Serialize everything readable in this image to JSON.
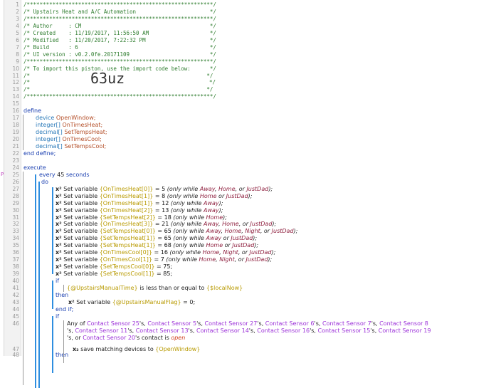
{
  "lines": [
    {
      "n": "1",
      "text": "/**********************************************************/"
    },
    {
      "n": "2",
      "text": "/* Upstairs Heat and A/C Automation                       */"
    },
    {
      "n": "3",
      "text": "/**********************************************************/"
    },
    {
      "n": "4",
      "text": "/* Author     : CM                                        */"
    },
    {
      "n": "5",
      "text": "/* Created    : 11/19/2017, 11:56:50 AM                   */"
    },
    {
      "n": "6",
      "text": "/* Modified   : 11/20/2017, 7:22:32 PM                    */"
    },
    {
      "n": "7",
      "text": "/* Build      : 6                                         */"
    },
    {
      "n": "8",
      "text": "/* UI version : v0.2.0fe.20171109                         */"
    },
    {
      "n": "9",
      "text": "/**********************************************************/"
    },
    {
      "n": "10",
      "text": "/* To import this piston, use the import code below:      */"
    },
    {
      "n": "11",
      "text": "/*                                                       */"
    },
    {
      "n": "12a",
      "text": "/*"
    },
    {
      "n": "12b",
      "text": "*/"
    },
    {
      "n": "13",
      "text": "/*                                                       */"
    },
    {
      "n": "14",
      "text": "/**********************************************************/"
    }
  ],
  "import_code": "63uz",
  "line_numbers": [
    "1",
    "2",
    "3",
    "4",
    "5",
    "6",
    "7",
    "8",
    "9",
    "10",
    "11",
    "12",
    "13",
    "14",
    "15",
    "16",
    "17",
    "18",
    "19",
    "20",
    "21",
    "22",
    "23",
    "24",
    "25",
    "26",
    "27",
    "28",
    "29",
    "30",
    "31",
    "32",
    "33",
    "34",
    "35",
    "36",
    "37",
    "38",
    "39",
    "40",
    "41",
    "42",
    "43",
    "44",
    "45",
    "46",
    "47",
    "48"
  ],
  "define": {
    "kw_define": "define",
    "decls": [
      {
        "type": "device",
        "name": "OpenWindow;"
      },
      {
        "type": "integer[]",
        "name": "OnTimesHeat;"
      },
      {
        "type": "decimal[]",
        "name": "SetTempsHeat;"
      },
      {
        "type": "integer[]",
        "name": "OnTimesCool;"
      },
      {
        "type": "decimal[]",
        "name": "SetTempsCool;"
      }
    ],
    "end": "end define;"
  },
  "execute": {
    "kw": "execute",
    "every": "every",
    "every_num": "45",
    "every_unit": "seconds",
    "do": "do",
    "sets": [
      {
        "var": "{OnTimesHeat[0]}",
        "val": "5",
        "cond": "(only while Away, Home, or JustDad);"
      },
      {
        "var": "{OnTimesHeat[1]}",
        "val": "8",
        "cond": "(only while Home or JustDad);"
      },
      {
        "var": "{OnTimesHeat[1]}",
        "val": "12",
        "cond": "(only while Away);"
      },
      {
        "var": "{OnTimesHeat[2]}",
        "val": "13",
        "cond": "(only while Away);"
      },
      {
        "var": "{SetTempsHeat[2]}",
        "val": "18",
        "cond": "(only while Home);"
      },
      {
        "var": "{OnTimesHeat[3]}",
        "val": "21",
        "cond": "(only while Away, Home, or JustDad);"
      },
      {
        "var": "{SetTempsHeat[0]}",
        "val": "65",
        "cond": "(only while Away, Home, Night, or JustDad);"
      },
      {
        "var": "{SetTempsHeat[1]}",
        "val": "65",
        "cond": "(only while Away or JustDad);"
      },
      {
        "var": "{SetTempsHeat[1]}",
        "val": "68",
        "cond": "(only while Home or JustDad);"
      },
      {
        "var": "{OnTimesCool[0]}",
        "val": "16",
        "cond": "(only while Home, Night, or JustDad);"
      },
      {
        "var": "{OnTimesCool[1]}",
        "val": "7",
        "cond": "(only while Home, Night, or JustDad);"
      },
      {
        "var": "{SetTempsCool[0]}",
        "val": "75;",
        "cond": ""
      },
      {
        "var": "{SetTempsCool[1]}",
        "val": "85;",
        "cond": ""
      }
    ],
    "set_label": "Set variable",
    "if1": "if",
    "cond1_a": "{@UpstairsManualTime}",
    "cond1_op": "is less than or equal to",
    "cond1_b": "{$localNow}",
    "then": "then",
    "set2_var": "{@UpstairsManualFlag}",
    "set2_val": "= 0;",
    "endif": "end if;",
    "if2": "if",
    "any_line1": "Any of Contact Sensor 25's, Contact Sensor 5's, Contact Sensor 27's, Contact Sensor 6's, Contact Sensor 7's, Contact Sensor 8",
    "any_line2": "'s, Contact Sensor 11's, Contact Sensor 13's, Contact Sensor 14's, Contact Sensor 16's, Contact Sensor 15's, Contact Sensor 19",
    "any_line3": "'s, or Contact Sensor 20's contact is open",
    "save_label": "save matching devices to",
    "save_var": "{OpenWindow}",
    "then2": "then"
  }
}
